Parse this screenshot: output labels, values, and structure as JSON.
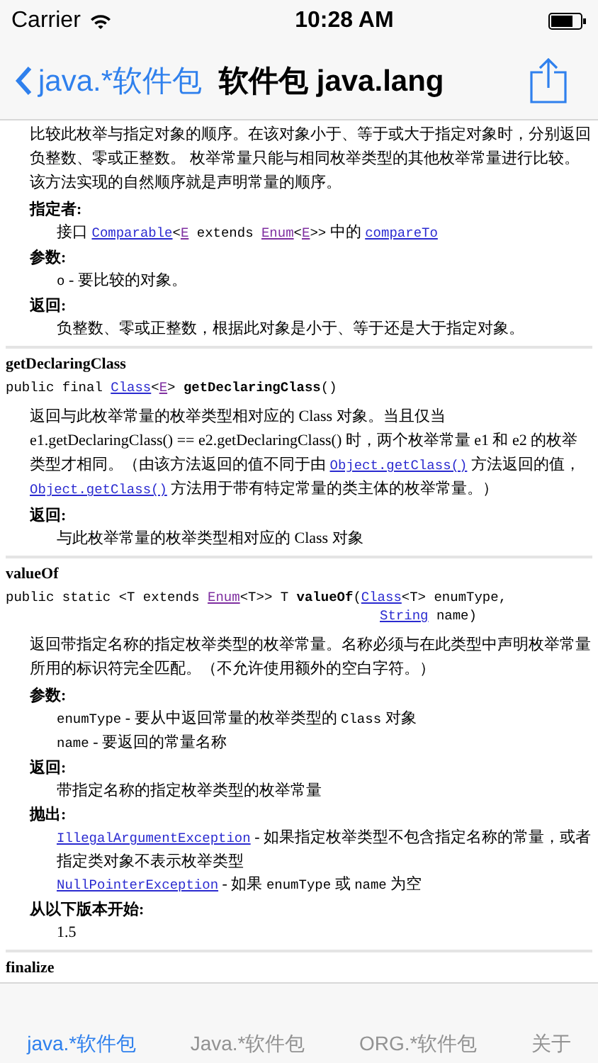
{
  "status_bar": {
    "carrier": "Carrier",
    "time": "10:28 AM"
  },
  "nav_bar": {
    "back_label": "java.*软件包",
    "title": "软件包 java.lang"
  },
  "sections": [
    {
      "description": [
        {
          "kind": "text",
          "text": "比较此枚举与指定对象的顺序。在该对象小于、等于或大于指定对象时，分别返回负整数、零或正整数。 枚举常量只能与相同枚举类型的其他枚举常量进行比较。该方法实现的自然顺序就是声明常量的顺序。"
        }
      ],
      "fields": [
        {
          "label": "指定者:",
          "items": [
            [
              {
                "kind": "text",
                "text": "接口 "
              },
              {
                "kind": "link",
                "text": "Comparable"
              },
              {
                "kind": "code",
                "text": "<"
              },
              {
                "kind": "visited-link",
                "text": "E"
              },
              {
                "kind": "code",
                "text": " extends "
              },
              {
                "kind": "visited-link",
                "text": "Enum"
              },
              {
                "kind": "code",
                "text": "<"
              },
              {
                "kind": "visited-link",
                "text": "E"
              },
              {
                "kind": "code",
                "text": ">>"
              },
              {
                "kind": "text",
                "text": " 中的 "
              },
              {
                "kind": "link",
                "text": "compareTo"
              }
            ]
          ]
        },
        {
          "label": "参数:",
          "items": [
            [
              {
                "kind": "code",
                "text": "o"
              },
              {
                "kind": "text",
                "text": " - 要比较的对象。"
              }
            ]
          ]
        },
        {
          "label": "返回:",
          "items": [
            [
              {
                "kind": "text",
                "text": "负整数、零或正整数，根据此对象是小于、等于还是大于指定对象。"
              }
            ]
          ]
        }
      ]
    },
    {
      "heading": "getDeclaringClass",
      "signature": [
        [
          {
            "kind": "code",
            "text": "public final "
          },
          {
            "kind": "link",
            "text": "Class"
          },
          {
            "kind": "code",
            "text": "<"
          },
          {
            "kind": "visited-link",
            "text": "E"
          },
          {
            "kind": "code",
            "text": "> "
          },
          {
            "kind": "strong",
            "text": "getDeclaringClass"
          },
          {
            "kind": "code",
            "text": "()"
          }
        ]
      ],
      "description": [
        {
          "kind": "text",
          "text": "返回与此枚举常量的枚举类型相对应的 Class 对象。当且仅当 e1.getDeclaringClass() == e2.getDeclaringClass() 时，两个枚举常量 e1 和 e2 的枚举类型才相同。（由该方法返回的值不同于由 "
        },
        {
          "kind": "link",
          "text": "Object.getClass()"
        },
        {
          "kind": "text",
          "text": " 方法返回的值，"
        },
        {
          "kind": "link",
          "text": "Object.getClass()"
        },
        {
          "kind": "text",
          "text": " 方法用于带有特定常量的类主体的枚举常量。）"
        }
      ],
      "fields": [
        {
          "label": "返回:",
          "items": [
            [
              {
                "kind": "text",
                "text": "与此枚举常量的枚举类型相对应的 Class 对象"
              }
            ]
          ]
        }
      ]
    },
    {
      "heading": "valueOf",
      "signature": [
        [
          {
            "kind": "code",
            "text": "public static <T extends "
          },
          {
            "kind": "visited-link",
            "text": "Enum"
          },
          {
            "kind": "code",
            "text": "<T>> T "
          },
          {
            "kind": "strong",
            "text": "valueOf"
          },
          {
            "kind": "code",
            "text": "("
          },
          {
            "kind": "link",
            "text": "Class"
          },
          {
            "kind": "code",
            "text": "<T> enumType,"
          }
        ],
        [
          {
            "kind": "link",
            "text": "String"
          },
          {
            "kind": "code",
            "text": " name)"
          }
        ]
      ],
      "description": [
        {
          "kind": "text",
          "text": "返回带指定名称的指定枚举类型的枚举常量。名称必须与在此类型中声明枚举常量所用的标识符完全匹配。（不允许使用额外的空白字符。）"
        }
      ],
      "fields": [
        {
          "label": "参数:",
          "items": [
            [
              {
                "kind": "code",
                "text": "enumType"
              },
              {
                "kind": "text",
                "text": " - 要从中返回常量的枚举类型的 "
              },
              {
                "kind": "code",
                "text": "Class"
              },
              {
                "kind": "text",
                "text": " 对象"
              }
            ],
            [
              {
                "kind": "code",
                "text": "name"
              },
              {
                "kind": "text",
                "text": " - 要返回的常量名称"
              }
            ]
          ]
        },
        {
          "label": "返回:",
          "items": [
            [
              {
                "kind": "text",
                "text": "带指定名称的指定枚举类型的枚举常量"
              }
            ]
          ]
        },
        {
          "label": "抛出:",
          "items": [
            [
              {
                "kind": "link",
                "text": "IllegalArgumentException"
              },
              {
                "kind": "text",
                "text": " - 如果指定枚举类型不包含指定名称的常量，或者指定类对象不表示枚举类型"
              }
            ],
            [
              {
                "kind": "link",
                "text": "NullPointerException"
              },
              {
                "kind": "text",
                "text": " - 如果 "
              },
              {
                "kind": "code",
                "text": "enumType"
              },
              {
                "kind": "text",
                "text": " 或 "
              },
              {
                "kind": "code",
                "text": "name"
              },
              {
                "kind": "text",
                "text": " 为空"
              }
            ]
          ]
        },
        {
          "label": "从以下版本开始:",
          "items": [
            [
              {
                "kind": "text",
                "text": "1.5"
              }
            ]
          ]
        }
      ]
    },
    {
      "heading": "finalize"
    }
  ],
  "tab_bar": [
    {
      "label": "java.*软件包",
      "selected": true
    },
    {
      "label": "Java.*软件包",
      "selected": false
    },
    {
      "label": "ORG.*软件包",
      "selected": false
    },
    {
      "label": "关于",
      "selected": false
    }
  ]
}
